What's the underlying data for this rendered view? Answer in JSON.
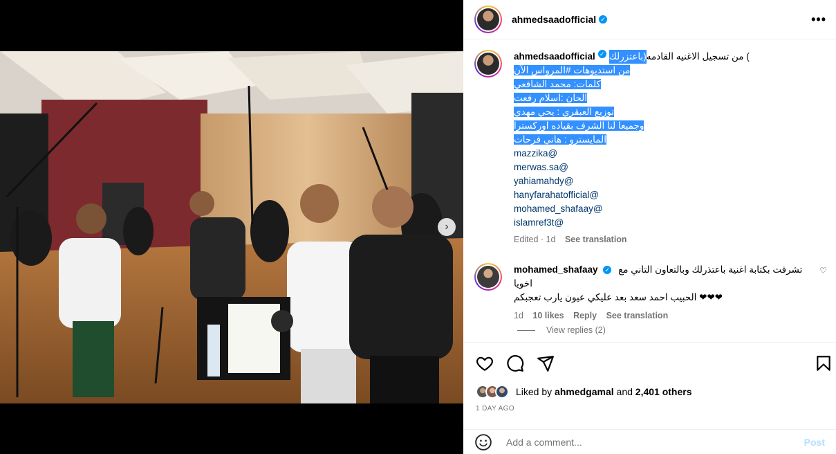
{
  "post": {
    "username": "ahmedsaadofficial",
    "more_label": "•••"
  },
  "caption": {
    "username": "ahmedsaadofficial",
    "line1_prefix": "من تسجيل الاغنيه القادمه (",
    "line1_highlight": "باعتزرلك)",
    "lines": [
      "من استديوهات #المرواس الآن",
      "كلمات: محمد الشافعي",
      "الحان :اسلام رفعت",
      "توزيع العبقري : يحي مهدي",
      "وجميعا لنا الشرف بقياده اوركسترا",
      "المايسترو : هاني فرحات"
    ],
    "mentions": [
      "mazzika@",
      "merwas.sa@",
      "yahiamahdy@",
      "hanyfarahatofficial@",
      "mohamed_shafaay@",
      "islamref3t@"
    ],
    "edited": "Edited · 1d",
    "see_translation": "See translation"
  },
  "comment": {
    "username": "mohamed_shafaay",
    "line1": "تشرفت بكتابة اغنية باعتذرلك وبالتعاون التاني مع اخويا",
    "line2": "الحبيب احمد سعد بعد عليكي عيون يارب تعجبكم ❤❤❤",
    "time": "1d",
    "likes": "10 likes",
    "reply": "Reply",
    "see_translation": "See translation",
    "view_replies": "View replies (2)"
  },
  "likes": {
    "prefix": "Liked by",
    "user": "ahmedgamal",
    "and": "and",
    "others": "2,401 others"
  },
  "time_ago": "1 DAY AGO",
  "comment_box": {
    "placeholder": "Add a comment...",
    "post_label": "Post"
  },
  "carousel": {
    "next_icon": "chevron-right",
    "dot_count": 6,
    "active_dot": 0
  },
  "colors": {
    "highlight": "#3390ff",
    "verified": "#0095f6",
    "mention": "#00376b",
    "post_disabled": "#b2dffc"
  }
}
